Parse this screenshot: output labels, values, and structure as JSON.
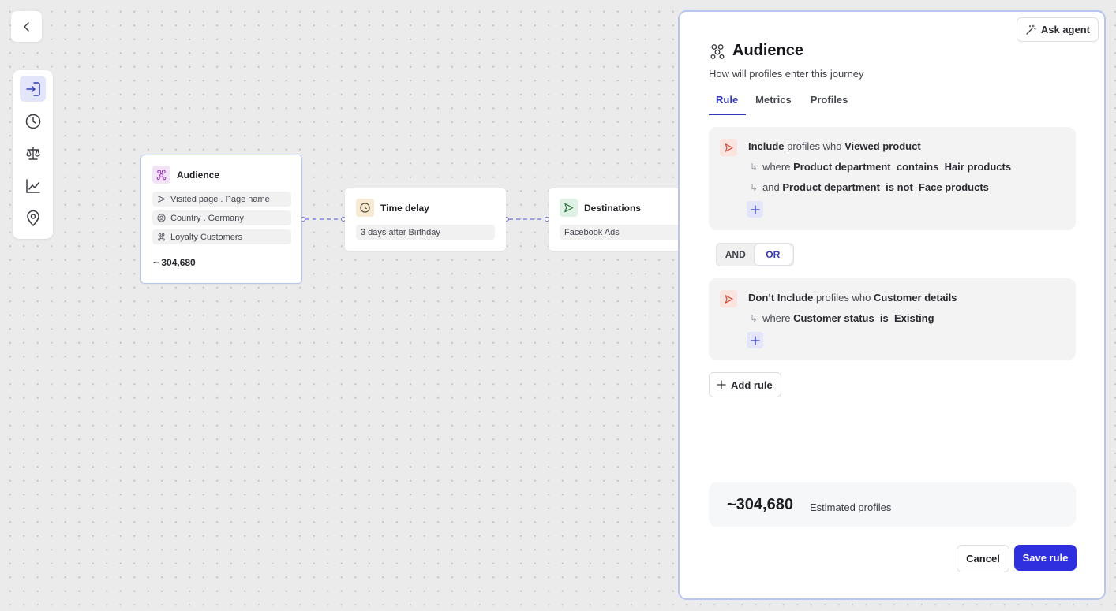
{
  "canvas": {
    "nodes": {
      "audience": {
        "title": "Audience",
        "chips": [
          "Visited page . Page name",
          "Country . Germany",
          "Loyalty Customers"
        ],
        "count": "~ 304,680"
      },
      "time_delay": {
        "title": "Time delay",
        "chips": [
          "3 days after Birthday"
        ]
      },
      "destinations": {
        "title": "Destinations",
        "chips": [
          "Facebook Ads"
        ]
      }
    }
  },
  "panel": {
    "ask_agent_label": "Ask agent",
    "title": "Audience",
    "subtitle": "How will profiles enter this journey",
    "tabs": [
      "Rule",
      "Metrics",
      "Profiles"
    ],
    "active_tab": "Rule",
    "rules": [
      {
        "mode": "Include",
        "mid": " profiles who ",
        "event": "Viewed product",
        "conditions": [
          {
            "joiner": "where",
            "field": "Product department",
            "op": "contains",
            "value": "Hair products"
          },
          {
            "joiner": "and",
            "field": "Product department",
            "op": "is not",
            "value": "Face products"
          }
        ]
      },
      {
        "mode": "Don’t Include",
        "mid": " profiles who ",
        "event": "Customer details",
        "conditions": [
          {
            "joiner": "where",
            "field": "Customer status",
            "op": "is",
            "value": "Existing"
          }
        ]
      }
    ],
    "logic_toggle": {
      "options": [
        "AND",
        "OR"
      ],
      "selected": "OR"
    },
    "add_rule_label": "Add rule",
    "estimate": {
      "value": "~304,680",
      "label": "Estimated profiles"
    },
    "cancel_label": "Cancel",
    "save_label": "Save rule"
  },
  "colors": {
    "accent": "#2f2fe0",
    "accent_text": "#3438b8",
    "rule_icon_bg": "#fbe3df",
    "panel_border": "#b7c6ee"
  },
  "icons": {
    "back": "chevron-left-icon",
    "toolbar": [
      "enter-icon",
      "clock-icon",
      "scale-icon",
      "chart-icon",
      "location-pin-icon"
    ],
    "audience": "audience-icon",
    "ask_agent": "magic-wand-icon"
  }
}
